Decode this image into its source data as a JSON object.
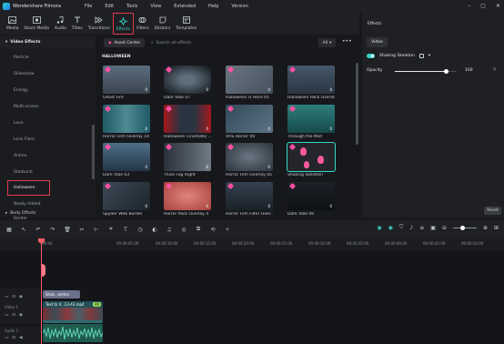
{
  "app": {
    "name": "Wondershare Filmora",
    "menu": [
      "File",
      "Edit",
      "Tools",
      "View",
      "Extended",
      "Help",
      "Version"
    ]
  },
  "toolbar": {
    "items": [
      {
        "label": "Media",
        "icon": "media-icon"
      },
      {
        "label": "Stock Media",
        "icon": "stock-media-icon"
      },
      {
        "label": "Audio",
        "icon": "audio-icon"
      },
      {
        "label": "Titles",
        "icon": "titles-icon"
      },
      {
        "label": "Transitions",
        "icon": "transitions-icon"
      },
      {
        "label": "Effects",
        "icon": "effects-icon",
        "active": true
      },
      {
        "label": "Filters",
        "icon": "filters-icon"
      },
      {
        "label": "Stickers",
        "icon": "stickers-icon"
      },
      {
        "label": "Templates",
        "icon": "templates-icon"
      }
    ]
  },
  "leftnav": {
    "header": "Video Effects",
    "items": [
      "Particle",
      "Slideshow",
      "Energy",
      "Multi-screen",
      "Love",
      "Lens Flare",
      "Anime",
      "Starburst",
      "Halloween",
      "Newly Added",
      "Border",
      "Blur"
    ],
    "selected": "Halloween",
    "footer": "Body Effects"
  },
  "effects": {
    "asset_center": "Asset Center",
    "search_placeholder": "Search all effects",
    "filter_value": "All",
    "section": "HALLOWEEN",
    "cards": [
      {
        "title": "Ghost Fire",
        "badge": "0"
      },
      {
        "title": "Dark Vibe 07",
        "badge": "0"
      },
      {
        "title": "Halloween is Here 05",
        "badge": "0"
      },
      {
        "title": "Halloween Pack Overlay",
        "badge": "0"
      },
      {
        "title": "Horror Film Overlay 19",
        "badge": "0"
      },
      {
        "title": "Halloween Cinematic ...",
        "badge": "0"
      },
      {
        "title": "VHS Horror 09",
        "badge": "0"
      },
      {
        "title": "Through the Mist",
        "badge": "0"
      },
      {
        "title": "Dark Vibe 03",
        "badge": "0"
      },
      {
        "title": "Thick Fog Right",
        "badge": "0"
      },
      {
        "title": "Horror Film Overlay 05",
        "badge": "0"
      },
      {
        "title": "Shaking Skeleton",
        "badge": "",
        "selected": true
      },
      {
        "title": "Spyder Web Border",
        "badge": "0"
      },
      {
        "title": "Horror Pack Overlay 4",
        "badge": "0"
      },
      {
        "title": "Horror Film Filter Over...",
        "badge": "0"
      },
      {
        "title": "Dark Vibe 06",
        "badge": "0"
      }
    ]
  },
  "rightpanel": {
    "title": "Effects",
    "tab": "Video",
    "effect_name": "Shaking Skeleton",
    "opacity_label": "Opacity",
    "opacity_value": "100",
    "reset_label": "Reset"
  },
  "timeline": {
    "ruler": [
      "00:00",
      "00:00:05:00",
      "00:00:10:00",
      "00:00:15:00",
      "00:00:20:00",
      "00:00:25:00",
      "00:00:30:00",
      "00:00:35:00",
      "00:00:40:00",
      "00:00:45:00",
      "00:00:50:00",
      "00:00:55:00"
    ],
    "fx_clip": "Shak...eleton",
    "video_clip": "Text to V...13-43.mp4",
    "track_video": "Video 1",
    "track_audio": "Audio 1",
    "badge": "4K"
  },
  "colors": {
    "accent": "#37d7c7",
    "highlight_box": "#e23b4a",
    "bg": "#17181c"
  }
}
